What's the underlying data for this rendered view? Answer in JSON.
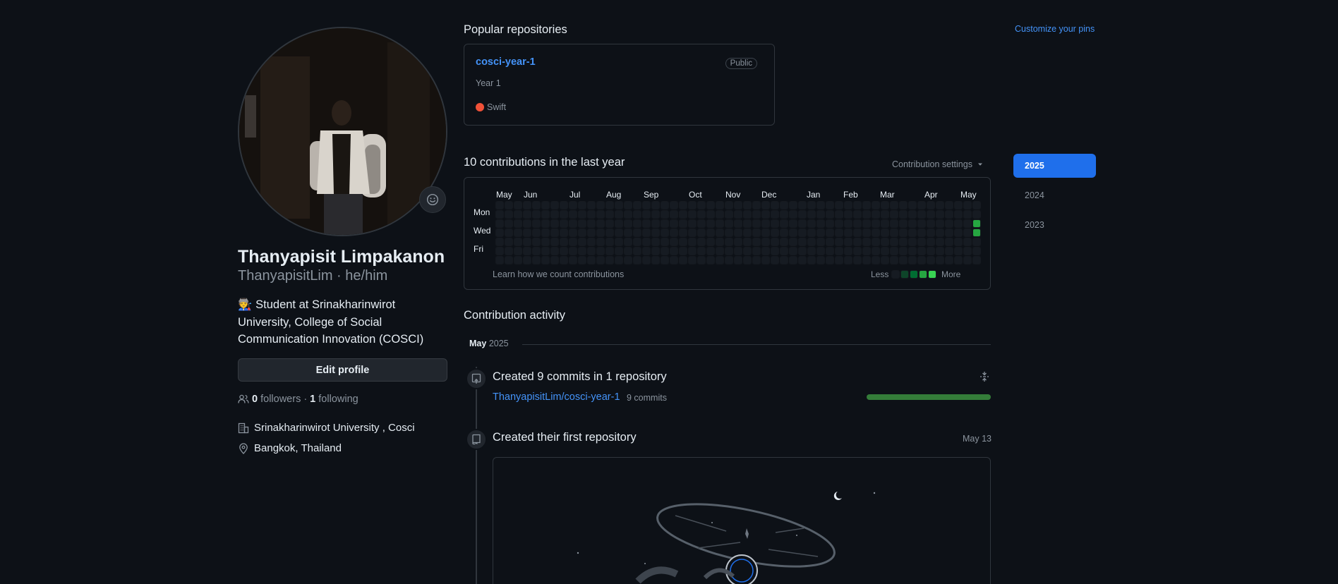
{
  "profile": {
    "name": "Thanyapisit Limpakanon",
    "login_line": "ThanyapisitLim · he/him",
    "bio": "🧑‍🏭 Student at Srinakharinwirot University, College of Social Communication Innovation (COSCI)",
    "edit_label": "Edit profile",
    "followers_count": "0",
    "followers_label": "followers",
    "separator": "·",
    "following_count": "1",
    "following_label": "following",
    "organization": "Srinakharinwirot University , Cosci",
    "location": "Bangkok, Thailand"
  },
  "pinned": {
    "heading": "Popular repositories",
    "customize_label": "Customize your pins",
    "repo": {
      "name": "cosci-year-1",
      "visibility": "Public",
      "description": "Year 1",
      "language": "Swift",
      "language_color": "#F05138"
    }
  },
  "contributions": {
    "heading": "10 contributions in the last year",
    "settings_label": "Contribution settings",
    "months": [
      "May",
      "Jun",
      "Jul",
      "Aug",
      "Sep",
      "Oct",
      "Nov",
      "Dec",
      "Jan",
      "Feb",
      "Mar",
      "Apr",
      "May"
    ],
    "days": [
      "Mon",
      "Wed",
      "Fri"
    ],
    "learn_label": "Learn how we count contributions",
    "less_label": "Less",
    "more_label": "More",
    "active_cells": [
      {
        "week": 52,
        "day": 2,
        "level": 3
      },
      {
        "week": 52,
        "day": 3,
        "level": 3
      }
    ],
    "colors": {
      "empty": "#161b22",
      "level1": "#0e4429",
      "level2": "#006d32",
      "level3": "#26a641",
      "level4": "#39d353"
    }
  },
  "years": [
    "2025",
    "2024",
    "2023"
  ],
  "selected_year": "2025",
  "activity": {
    "heading": "Contribution activity",
    "month": "May",
    "year": "2025",
    "commits": {
      "title": "Created 9 commits in 1 repository",
      "repo": "ThanyapisitLim/cosci-year-1",
      "count": "9 commits"
    },
    "first_repo": {
      "title": "Created their first repository",
      "date": "May 13"
    }
  }
}
